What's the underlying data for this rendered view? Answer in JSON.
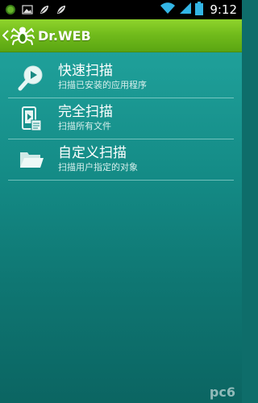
{
  "status_bar": {
    "time": "9:12",
    "left_icons": [
      "android-icon",
      "image-icon",
      "leaf-icon",
      "leaf-icon"
    ],
    "right_icons": [
      "wifi-icon",
      "signal-icon",
      "battery-icon"
    ]
  },
  "action_bar": {
    "title": "Dr.WEB",
    "logo": "dr-web-spider-logo-icon",
    "background": "#76c020"
  },
  "menu": {
    "items": [
      {
        "title": "快速扫描",
        "subtitle": "扫描已安装的应用程序",
        "icon": "magnifier-play-icon"
      },
      {
        "title": "完全扫描",
        "subtitle": "扫描所有文件",
        "icon": "phone-file-icon"
      },
      {
        "title": "自定义扫描",
        "subtitle": "扫描用户指定的对象",
        "icon": "folder-icon"
      }
    ]
  },
  "watermark": {
    "text": "pc6"
  },
  "colors": {
    "content_top": "#1fa09a",
    "content_bottom": "#0b6562",
    "divider": "#bfe9e4"
  }
}
